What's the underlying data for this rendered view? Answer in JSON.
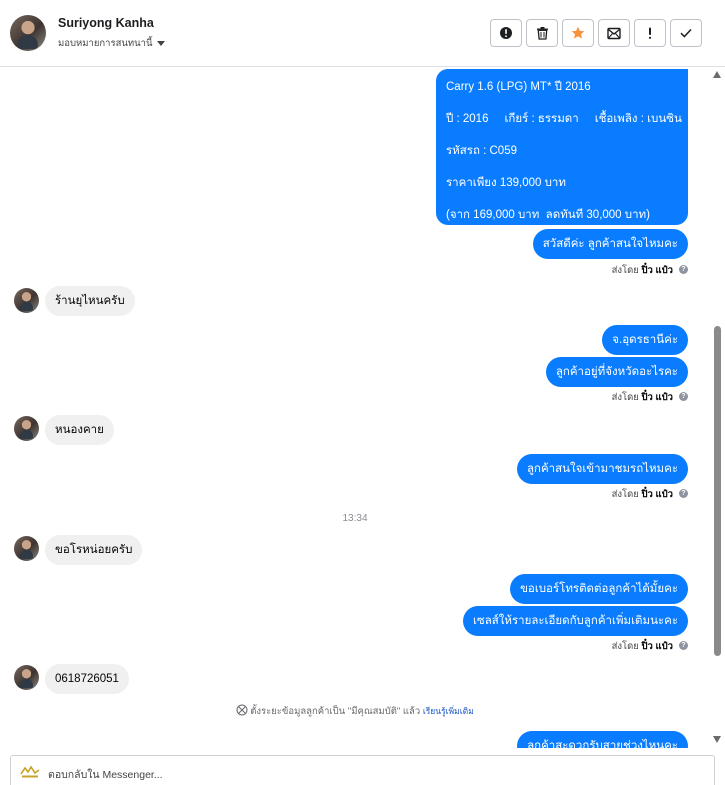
{
  "header": {
    "name": "Suriyong Kanha",
    "assign_label": "มอบหมายการสนทนานี้"
  },
  "toolbar": [
    {
      "name": "spam-button",
      "icon": "exclamation-circle-icon"
    },
    {
      "name": "delete-button",
      "icon": "trash-icon"
    },
    {
      "name": "star-button",
      "icon": "star-icon",
      "color": "#f7923b"
    },
    {
      "name": "mark-unread-button",
      "icon": "envelope-icon"
    },
    {
      "name": "follow-up-button",
      "icon": "exclamation-icon"
    },
    {
      "name": "mark-done-button",
      "icon": "check-icon"
    }
  ],
  "messages": {
    "card_lines": [
      "Carry 1.6 (LPG) MT* ปี 2016",
      "ปี : 2016     เกียร์ : ธรรมดา     เชื้อเพลิง : เบนซิน",
      "รหัสรถ : C059",
      "ราคาเพียง 139,000 บาท",
      "(จาก 169,000 บาท  ลดทันที 30,000 บาท)"
    ],
    "out_1": "สวัสดีค่ะ ลูกค้าสนใจไหมคะ",
    "in_1": "ร้านยุไหนครับ",
    "out_2": "จ.อุดรธานีค่ะ",
    "out_3": "ลูกค้าอยู่ที่จังหวัดอะไรคะ",
    "in_2": "หนองคาย",
    "out_4": "ลูกค้าสนใจเข้ามาชมรถไหมคะ",
    "time": "13:34",
    "in_3": "ขอโรหน่อยครับ",
    "out_5": "ขอเบอร์โทรติดต่อลูกค้าได้มั้ยคะ",
    "out_6": "เซลส์ให้รายละเอียดกับลูกค้าเพิ่มเติมนะคะ",
    "in_4": "0618726051",
    "out_7": "ลูกค้าสะดวกรับสายช่วงไหนคะ"
  },
  "sent_by": {
    "prefix": "ส่งโดย",
    "agent": "ปิ๋ว แป๋ว"
  },
  "system_note": {
    "text": "ตั้งระยะข้อมูลลูกค้าเป็น \"มีคุณสมบัติ\" แล้ว",
    "link": "เรียนรู้เพิ่มเติม"
  },
  "composer": {
    "placeholder": "ตอบกลับใน Messenger..."
  },
  "colors": {
    "outgoing_bubble": "#0a7cff",
    "incoming_bubble": "#f0f0f0",
    "star": "#f7923b"
  }
}
